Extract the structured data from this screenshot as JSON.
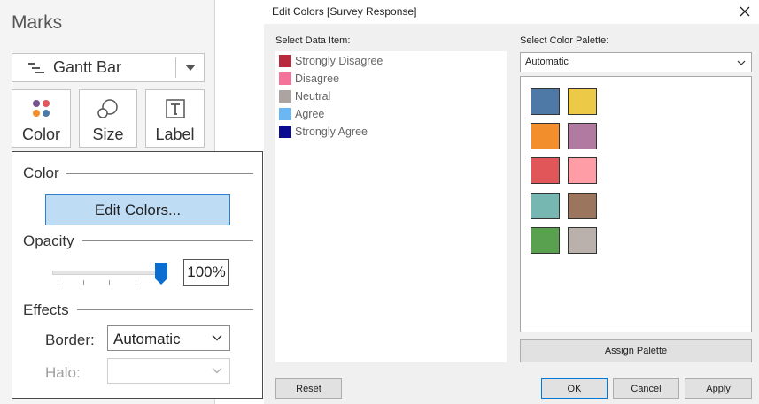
{
  "marks": {
    "title": "Marks",
    "mark_type": "Gantt Bar",
    "shelf_buttons": {
      "color": "Color",
      "size": "Size",
      "label": "Label"
    }
  },
  "color_popup": {
    "color_heading": "Color",
    "edit_colors_label": "Edit Colors...",
    "opacity_heading": "Opacity",
    "opacity_value": "100%",
    "opacity_level_percent": 100,
    "effects_heading": "Effects",
    "border_label": "Border:",
    "border_value": "Automatic",
    "halo_label": "Halo:",
    "halo_value": ""
  },
  "dialog": {
    "title": "Edit Colors [Survey Response]",
    "select_data_item_label": "Select Data Item:",
    "select_palette_label": "Select Color Palette:",
    "palette_value": "Automatic",
    "data_items": [
      {
        "label": "Strongly Disagree",
        "color": "#b72b3c"
      },
      {
        "label": "Disagree",
        "color": "#f4739a"
      },
      {
        "label": "Neutral",
        "color": "#aba4a0"
      },
      {
        "label": "Agree",
        "color": "#6cb6f2"
      },
      {
        "label": "Strongly Agree",
        "color": "#0c0a8e"
      }
    ],
    "palette_colors": [
      "#4e79a7",
      "#edc948",
      "#f28e2b",
      "#b07aa1",
      "#e15759",
      "#ff9da7",
      "#76b7b2",
      "#9c755f",
      "#59a14f",
      "#bab0ac"
    ],
    "buttons": {
      "assign_palette": "Assign Palette",
      "reset": "Reset",
      "ok": "OK",
      "cancel": "Cancel",
      "apply": "Apply"
    }
  }
}
